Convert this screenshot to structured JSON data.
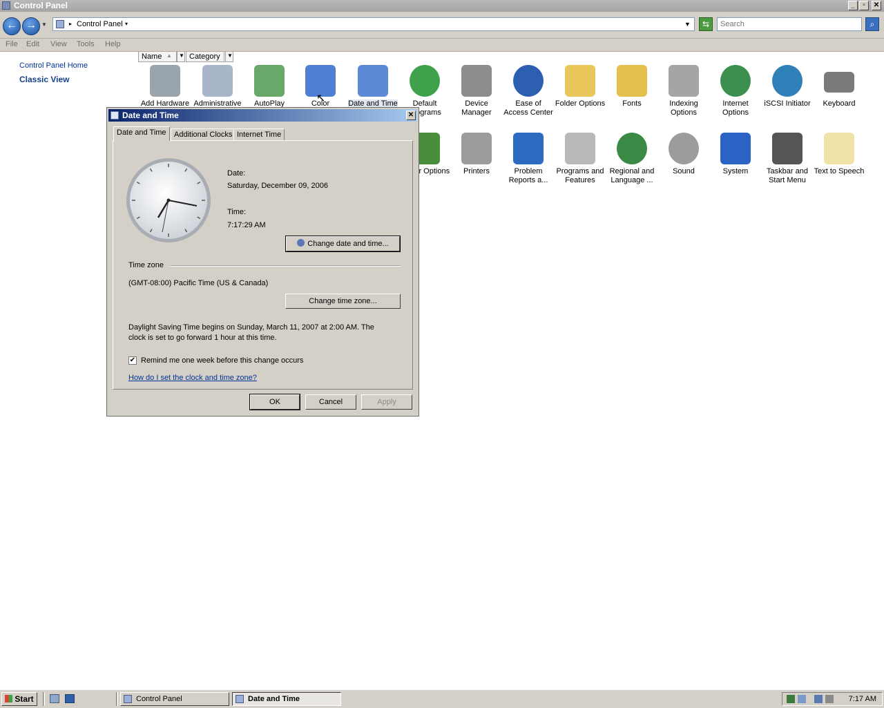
{
  "window": {
    "title": "Control Panel"
  },
  "address": {
    "path": "Control Panel",
    "search_placeholder": "Search"
  },
  "menu": [
    "File",
    "Edit",
    "View",
    "Tools",
    "Help"
  ],
  "left_pane": {
    "home_link": "Control Panel Home",
    "classic_view": "Classic View"
  },
  "columns": {
    "name": "Name",
    "category": "Category"
  },
  "icons_row1": [
    {
      "label": "Add Hardware",
      "icon": "add-hardware-icon",
      "color": "#9aa4ad"
    },
    {
      "label": "Administrative",
      "icon": "administrative-tools-icon",
      "color": "#a9b6c9"
    },
    {
      "label": "AutoPlay",
      "icon": "autoplay-icon",
      "color": "#6aa86a"
    },
    {
      "label": "Color",
      "icon": "color-icon",
      "color": "#4f7fd0"
    },
    {
      "label": "Date and Time",
      "icon": "date-time-icon",
      "color": "#5c8ad6"
    },
    {
      "label": "Default Programs",
      "icon": "default-programs-icon",
      "color": "#3fa14b"
    },
    {
      "label": "Device Manager",
      "icon": "device-manager-icon",
      "color": "#8d8d8d"
    },
    {
      "label": "Ease of Access Center",
      "icon": "ease-of-access-icon",
      "color": "#2c5fb0"
    },
    {
      "label": "Folder Options",
      "icon": "folder-options-icon",
      "color": "#e9c75a"
    },
    {
      "label": "Fonts",
      "icon": "fonts-icon",
      "color": "#e4c04e"
    },
    {
      "label": "Indexing Options",
      "icon": "indexing-options-icon",
      "color": "#a5a5a5"
    },
    {
      "label": "Internet Options",
      "icon": "internet-options-icon",
      "color": "#3b8f4f"
    },
    {
      "label": "iSCSI Initiator",
      "icon": "iscsi-initiator-icon",
      "color": "#2f7fb8"
    },
    {
      "label": "Keyboard",
      "icon": "keyboard-icon",
      "color": "#7a7a7a"
    }
  ],
  "icons_row2": [
    {
      "label": "Power Options",
      "icon": "power-options-icon",
      "color": "#4a8e3d"
    },
    {
      "label": "Printers",
      "icon": "printers-icon",
      "color": "#9c9c9c"
    },
    {
      "label": "Problem Reports a...",
      "icon": "problem-reports-icon",
      "color": "#2c6bc0"
    },
    {
      "label": "Programs and Features",
      "icon": "programs-features-icon",
      "color": "#b9b9b9"
    },
    {
      "label": "Regional and Language ...",
      "icon": "regional-language-icon",
      "color": "#3a8a46"
    },
    {
      "label": "Sound",
      "icon": "sound-icon",
      "color": "#9c9c9c"
    },
    {
      "label": "System",
      "icon": "system-icon",
      "color": "#2a63c4"
    },
    {
      "label": "Taskbar and Start Menu",
      "icon": "taskbar-start-menu-icon",
      "color": "#555555"
    },
    {
      "label": "Text to Speech",
      "icon": "text-to-speech-icon",
      "color": "#f0e3a8"
    }
  ],
  "dialog": {
    "title": "Date and Time",
    "tabs": [
      "Date and Time",
      "Additional Clocks",
      "Internet Time"
    ],
    "date_label": "Date:",
    "date_value": "Saturday, December 09, 2006",
    "time_label": "Time:",
    "time_value": "7:17:29 AM",
    "change_datetime_btn": "Change date and time...",
    "timezone_header": "Time zone",
    "timezone_value": "(GMT-08:00) Pacific Time (US & Canada)",
    "change_timezone_btn": "Change time zone...",
    "dst_line1": "Daylight Saving Time begins on Sunday, March 11, 2007 at 2:00 AM. The",
    "dst_line2": "clock is set to go forward 1 hour at this time.",
    "remind_label": "Remind me one week before this change occurs",
    "remind_checked": true,
    "help_link": "How do I set the clock and time zone?",
    "ok": "OK",
    "cancel": "Cancel",
    "apply": "Apply"
  },
  "taskbar": {
    "start": "Start",
    "tasks": [
      "Control Panel",
      "Date and Time"
    ],
    "clock": "7:17 AM"
  }
}
